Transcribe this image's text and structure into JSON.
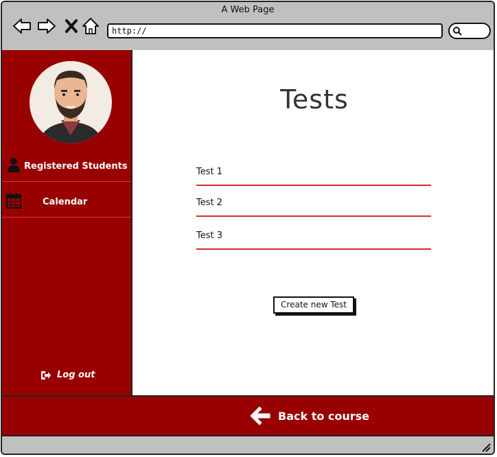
{
  "window": {
    "title": "A Web Page"
  },
  "toolbar": {
    "url": "http://"
  },
  "sidebar": {
    "items": [
      {
        "label": "Registered Students",
        "icon": "user-icon"
      },
      {
        "label": "Calendar",
        "icon": "calendar-icon"
      }
    ],
    "logout_label": "Log out"
  },
  "main": {
    "title": "Tests",
    "tests": [
      "Test 1",
      "Test 2",
      "Test 3"
    ],
    "create_label": "Create new Test"
  },
  "footer": {
    "back_label": "Back to course"
  },
  "colors": {
    "accent": "#990000",
    "underline": "#d22b2b",
    "chrome": "#c0c0c0"
  }
}
